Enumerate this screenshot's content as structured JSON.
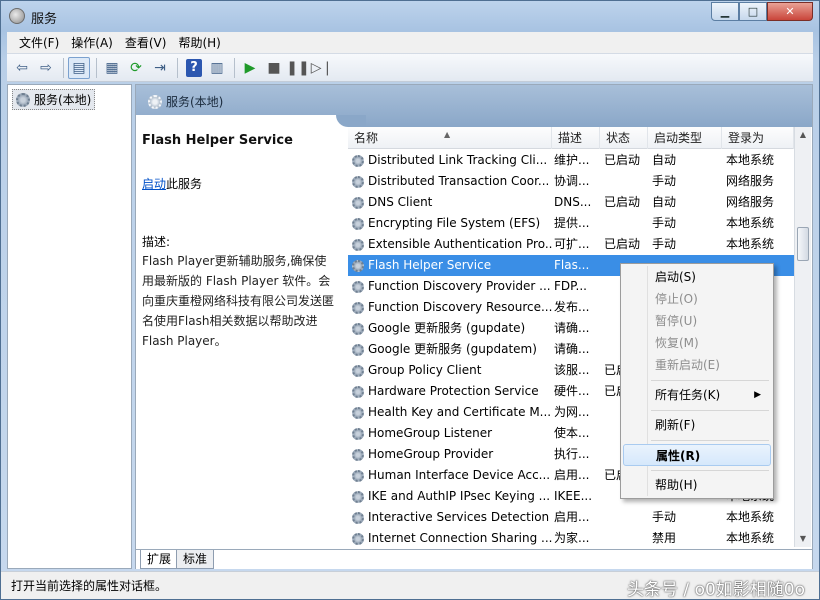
{
  "window": {
    "title": "服务"
  },
  "menu": [
    "文件(F)",
    "操作(A)",
    "查看(V)",
    "帮助(H)"
  ],
  "tree": {
    "root": "服务(本地)"
  },
  "pane": {
    "header": "服务(本地)",
    "detail_title": "Flash Helper Service",
    "start_link": "启动",
    "start_suffix": "此服务",
    "desc_label": "描述:",
    "desc_text": "Flash Player更新辅助服务,确保使用最新版的 Flash Player 软件。会向重庆重橙网络科技有限公司发送匿名使用Flash相关数据以帮助改进 Flash Player。"
  },
  "columns": {
    "name": "名称",
    "desc": "描述",
    "status": "状态",
    "type": "启动类型",
    "logon": "登录为"
  },
  "rows": [
    {
      "name": "Distributed Link Tracking Cli...",
      "desc": "维护...",
      "status": "已启动",
      "type": "自动",
      "logon": "本地系统"
    },
    {
      "name": "Distributed Transaction Coor...",
      "desc": "协调...",
      "status": "",
      "type": "手动",
      "logon": "网络服务"
    },
    {
      "name": "DNS Client",
      "desc": "DNS...",
      "status": "已启动",
      "type": "自动",
      "logon": "网络服务"
    },
    {
      "name": "Encrypting File System (EFS)",
      "desc": "提供...",
      "status": "",
      "type": "手动",
      "logon": "本地系统"
    },
    {
      "name": "Extensible Authentication Pro...",
      "desc": "可扩...",
      "status": "已启动",
      "type": "手动",
      "logon": "本地系统"
    },
    {
      "name": "Flash Helper Service",
      "desc": "Flas...",
      "status": "",
      "type": "",
      "logon": ""
    },
    {
      "name": "Function Discovery Provider ...",
      "desc": "FDP...",
      "status": "",
      "type": "",
      "logon": ""
    },
    {
      "name": "Function Discovery Resource...",
      "desc": "发布...",
      "status": "",
      "type": "",
      "logon": ""
    },
    {
      "name": "Google 更新服务 (gupdate)",
      "desc": "请确...",
      "status": "",
      "type": "",
      "logon": ""
    },
    {
      "name": "Google 更新服务 (gupdatem)",
      "desc": "请确...",
      "status": "",
      "type": "",
      "logon": ""
    },
    {
      "name": "Group Policy Client",
      "desc": "该服...",
      "status": "已启",
      "type": "",
      "logon": ""
    },
    {
      "name": "Hardware Protection Service",
      "desc": "硬件...",
      "status": "已启",
      "type": "",
      "logon": ""
    },
    {
      "name": "Health Key and Certificate M...",
      "desc": "为网...",
      "status": "",
      "type": "",
      "logon": ""
    },
    {
      "name": "HomeGroup Listener",
      "desc": "使本...",
      "status": "",
      "type": "",
      "logon": ""
    },
    {
      "name": "HomeGroup Provider",
      "desc": "执行...",
      "status": "",
      "type": "",
      "logon": ""
    },
    {
      "name": "Human Interface Device Acc...",
      "desc": "启用...",
      "status": "已启",
      "type": "",
      "logon": ""
    },
    {
      "name": "IKE and AuthIP IPsec Keying ...",
      "desc": "IKEE...",
      "status": "",
      "type": "",
      "logon": "本地系统"
    },
    {
      "name": "Interactive Services Detection",
      "desc": "启用...",
      "status": "",
      "type": "手动",
      "logon": "本地系统"
    },
    {
      "name": "Internet Connection Sharing ...",
      "desc": "为家...",
      "status": "",
      "type": "禁用",
      "logon": "本地系统"
    }
  ],
  "context_menu": {
    "start": "启动(S)",
    "stop": "停止(O)",
    "pause": "暂停(U)",
    "resume": "恢复(M)",
    "restart": "重新启动(E)",
    "all_tasks": "所有任务(K)",
    "refresh": "刷新(F)",
    "properties": "属性(R)",
    "help": "帮助(H)"
  },
  "tabs": {
    "extended": "扩展",
    "standard": "标准"
  },
  "status": {
    "text": "打开当前选择的属性对话框。"
  },
  "watermark": "头条号 / o0如影相随0o"
}
